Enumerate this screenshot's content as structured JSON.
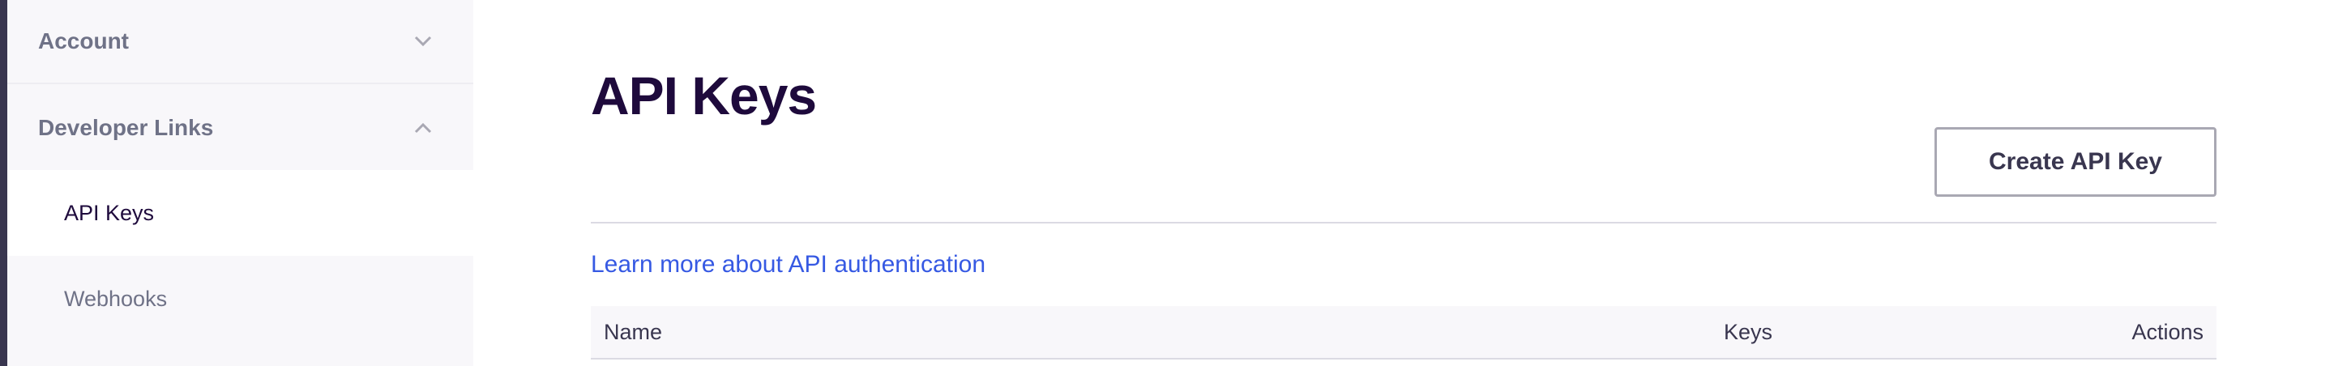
{
  "sidebar": {
    "sections": [
      {
        "label": "Account",
        "icon": "chevron-down-icon"
      },
      {
        "label": "Developer Links",
        "icon": "chevron-up-icon"
      }
    ],
    "items": [
      {
        "label": "API Keys",
        "active": true
      },
      {
        "label": "Webhooks",
        "active": false
      }
    ]
  },
  "main": {
    "title": "API Keys",
    "create_button_label": "Create API Key",
    "learn_more_link": "Learn more about API authentication",
    "table": {
      "columns": [
        "Name",
        "Keys",
        "Actions"
      ]
    }
  },
  "colors": {
    "heading": "#1e0a3c",
    "link": "#3659e3",
    "sidebar_bg": "#f8f7fa",
    "muted_text": "#6f7287"
  }
}
